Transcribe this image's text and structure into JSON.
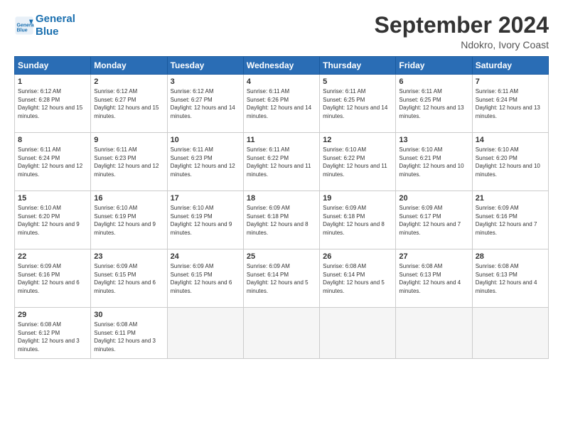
{
  "header": {
    "logo_line1": "General",
    "logo_line2": "Blue",
    "month_title": "September 2024",
    "location": "Ndokro, Ivory Coast"
  },
  "days_of_week": [
    "Sunday",
    "Monday",
    "Tuesday",
    "Wednesday",
    "Thursday",
    "Friday",
    "Saturday"
  ],
  "weeks": [
    [
      {
        "day": "1",
        "sunrise": "6:12 AM",
        "sunset": "6:28 PM",
        "daylight": "12 hours and 15 minutes."
      },
      {
        "day": "2",
        "sunrise": "6:12 AM",
        "sunset": "6:27 PM",
        "daylight": "12 hours and 15 minutes."
      },
      {
        "day": "3",
        "sunrise": "6:12 AM",
        "sunset": "6:27 PM",
        "daylight": "12 hours and 14 minutes."
      },
      {
        "day": "4",
        "sunrise": "6:11 AM",
        "sunset": "6:26 PM",
        "daylight": "12 hours and 14 minutes."
      },
      {
        "day": "5",
        "sunrise": "6:11 AM",
        "sunset": "6:25 PM",
        "daylight": "12 hours and 14 minutes."
      },
      {
        "day": "6",
        "sunrise": "6:11 AM",
        "sunset": "6:25 PM",
        "daylight": "12 hours and 13 minutes."
      },
      {
        "day": "7",
        "sunrise": "6:11 AM",
        "sunset": "6:24 PM",
        "daylight": "12 hours and 13 minutes."
      }
    ],
    [
      {
        "day": "8",
        "sunrise": "6:11 AM",
        "sunset": "6:24 PM",
        "daylight": "12 hours and 12 minutes."
      },
      {
        "day": "9",
        "sunrise": "6:11 AM",
        "sunset": "6:23 PM",
        "daylight": "12 hours and 12 minutes."
      },
      {
        "day": "10",
        "sunrise": "6:11 AM",
        "sunset": "6:23 PM",
        "daylight": "12 hours and 12 minutes."
      },
      {
        "day": "11",
        "sunrise": "6:11 AM",
        "sunset": "6:22 PM",
        "daylight": "12 hours and 11 minutes."
      },
      {
        "day": "12",
        "sunrise": "6:10 AM",
        "sunset": "6:22 PM",
        "daylight": "12 hours and 11 minutes."
      },
      {
        "day": "13",
        "sunrise": "6:10 AM",
        "sunset": "6:21 PM",
        "daylight": "12 hours and 10 minutes."
      },
      {
        "day": "14",
        "sunrise": "6:10 AM",
        "sunset": "6:20 PM",
        "daylight": "12 hours and 10 minutes."
      }
    ],
    [
      {
        "day": "15",
        "sunrise": "6:10 AM",
        "sunset": "6:20 PM",
        "daylight": "12 hours and 9 minutes."
      },
      {
        "day": "16",
        "sunrise": "6:10 AM",
        "sunset": "6:19 PM",
        "daylight": "12 hours and 9 minutes."
      },
      {
        "day": "17",
        "sunrise": "6:10 AM",
        "sunset": "6:19 PM",
        "daylight": "12 hours and 9 minutes."
      },
      {
        "day": "18",
        "sunrise": "6:09 AM",
        "sunset": "6:18 PM",
        "daylight": "12 hours and 8 minutes."
      },
      {
        "day": "19",
        "sunrise": "6:09 AM",
        "sunset": "6:18 PM",
        "daylight": "12 hours and 8 minutes."
      },
      {
        "day": "20",
        "sunrise": "6:09 AM",
        "sunset": "6:17 PM",
        "daylight": "12 hours and 7 minutes."
      },
      {
        "day": "21",
        "sunrise": "6:09 AM",
        "sunset": "6:16 PM",
        "daylight": "12 hours and 7 minutes."
      }
    ],
    [
      {
        "day": "22",
        "sunrise": "6:09 AM",
        "sunset": "6:16 PM",
        "daylight": "12 hours and 6 minutes."
      },
      {
        "day": "23",
        "sunrise": "6:09 AM",
        "sunset": "6:15 PM",
        "daylight": "12 hours and 6 minutes."
      },
      {
        "day": "24",
        "sunrise": "6:09 AM",
        "sunset": "6:15 PM",
        "daylight": "12 hours and 6 minutes."
      },
      {
        "day": "25",
        "sunrise": "6:09 AM",
        "sunset": "6:14 PM",
        "daylight": "12 hours and 5 minutes."
      },
      {
        "day": "26",
        "sunrise": "6:08 AM",
        "sunset": "6:14 PM",
        "daylight": "12 hours and 5 minutes."
      },
      {
        "day": "27",
        "sunrise": "6:08 AM",
        "sunset": "6:13 PM",
        "daylight": "12 hours and 4 minutes."
      },
      {
        "day": "28",
        "sunrise": "6:08 AM",
        "sunset": "6:13 PM",
        "daylight": "12 hours and 4 minutes."
      }
    ],
    [
      {
        "day": "29",
        "sunrise": "6:08 AM",
        "sunset": "6:12 PM",
        "daylight": "12 hours and 3 minutes."
      },
      {
        "day": "30",
        "sunrise": "6:08 AM",
        "sunset": "6:11 PM",
        "daylight": "12 hours and 3 minutes."
      },
      null,
      null,
      null,
      null,
      null
    ]
  ]
}
